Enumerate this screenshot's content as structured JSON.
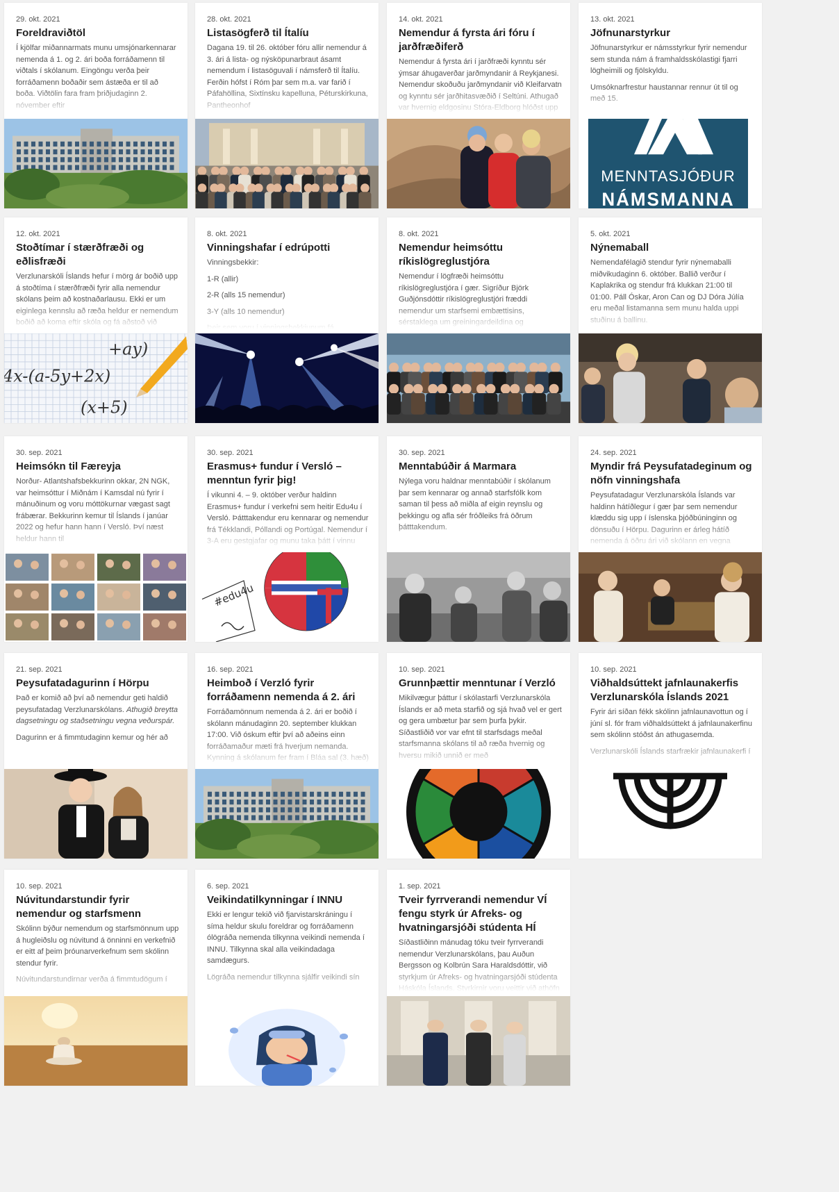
{
  "colors": {
    "background": "#f1f1f1",
    "card": "#ffffff",
    "title": "#222222",
    "body": "#555555"
  },
  "cards": [
    {
      "date": "29. okt. 2021",
      "title": "Foreldraviðtöl",
      "body": [
        "Í kjölfar miðannarmats munu umsjónarkennarar nemenda á 1. og 2. ári boða forráðamenn til viðtals í skólanum. Eingöngu verða þeir forráðamenn boðaðir sem ástæða er til að boða. Viðtölin fara fram þriðjudaginn 2. nóvember eftir"
      ],
      "image_icon": "school-building-image"
    },
    {
      "date": "28. okt. 2021",
      "title": "Listasögferð til Ítalíu",
      "body": [
        "Dagana 19. til 26. október fóru allir nemendur á 3. ári á lista- og nýsköpunarbraut ásamt nemendum í listasöguvali í námsferð til Ítalíu. Ferðin hófst í Róm þar sem m.a. var farið í Páfahöllina, Sixtínsku kapelluna, Péturskirkuna, Pantheonhof"
      ],
      "image_icon": "group-in-rome-image"
    },
    {
      "date": "14. okt. 2021",
      "title": "Nemendur á fyrsta ári fóru í jarðfræðiferð",
      "body": [
        "Nemendur á fyrsta ári í jarðfræði kynntu sér ýmsar áhugaverðar jarðmyndanir á Reykjanesi. Nemendur skoðuðu jarðmyndanir við Kleifarvatn og kynntu sér jarðhitasvæðið í Seltúni. Athugað var hvernig eldgosinu Stóra-Eldborg hlóðst upp og"
      ],
      "image_icon": "students-field-trip-image"
    },
    {
      "date": "13. okt. 2021",
      "title": "Jöfnunarstyrkur",
      "body": [
        "Jöfnunarstyrkur er námsstyrkur fyrir nemendur sem stunda nám á framhaldsskólastigi fjarri lögheimili og fjölskyldu.",
        "Umsóknarfrestur haustannar rennur út til og með 15."
      ],
      "image_icon": "menntasjodur-logo",
      "logo_line1": "MENNTASJÓÐUR",
      "logo_line2": "NÁMSMANNA"
    },
    {
      "date": "12. okt. 2021",
      "title": "Stoðtímar í stærðfræði og eðlisfræði",
      "body": [
        "Verzlunarskóli Íslands hefur í mörg ár boðið upp á stoðtíma í stærðfræði fyrir alla nemendur skólans þeim að kostnaðarlausu. Ekki er um eiginlega kennslu að ræða heldur er nemendum boðið að koma eftir skóla og fá aðstoð við heimanám og aðra"
      ],
      "image_icon": "math-pencil-image",
      "formula_top": "+ay)",
      "formula_mid": "4x-(a-5y+2x)",
      "formula_bot": "(x+5)"
    },
    {
      "date": "8. okt. 2021",
      "title": "Vinningshafar í edrúpotti",
      "body": [
        "Vinningsbekkir:",
        "1-R (allir)",
        "2-R (alls 15 nemendur)",
        "3-Y (alls 10 nemendur)",
        "Þeir sem voru í vinningsbekkjunum fá edrúpottinn"
      ],
      "image_icon": "concert-lights-image"
    },
    {
      "date": "8. okt. 2021",
      "title": "Nemendur heimsóttu ríkislögreglustjóra",
      "body": [
        "Nemendur í lögfræði heimsóttu ríkislögreglustjóra í gær. Sigríður Björk Guðjónsdóttir ríkislögreglustjóri fræddi nemendur um starfsemi embættisins, sérstaklega um greiningardeildina og almannavarnir. Að lokum kennarar eintdi neddi lög"
      ],
      "image_icon": "group-photo-image"
    },
    {
      "date": "5. okt. 2021",
      "title": "Nýnemaball",
      "body": [
        "Nemendafélagið stendur fyrir nýnemaballi miðvikudaginn 6. október. Ballið verður í Kaplakrika og stendur frá klukkan 21:00 til 01:00. Páll Óskar, Aron Can og DJ Dóra Júlía eru meðal listamanna sem munu halda uppi stuðinu á ballinu."
      ],
      "image_icon": "students-party-image"
    },
    {
      "date": "30. sep. 2021",
      "title": "Heimsókn til Færeyja",
      "body": [
        "Norður- Atlantshafsbekkurinn okkar, 2N NGK, var heimsóttur í Miðnám í Kamsdal nú fyrir í mánuðinum og voru móttökurnar vægast sagt frábærar. Bekkurinn kemur til Íslands í janúar 2022 og hefur hann hann í Versló. Því næst heldur hann til"
      ],
      "image_icon": "photo-collage-image"
    },
    {
      "date": "30. sep. 2021",
      "title": "Erasmus+ fundur í Versló – menntun fyrir þig!",
      "body": [
        "Í vikunni 4. – 9. október verður haldinn Erasmus+ fundur í verkefni sem heitir Edu4u í Versló. Þátttakendur eru kennarar og nemendur frá Tékklandi, Póllandi og Portúgal. Nemendur í 3-A eru gestgjafar og munu taka þátt í vinnu"
      ],
      "image_icon": "erasmus-drawing-image",
      "drawing_label": "#edu4u"
    },
    {
      "date": "30. sep. 2021",
      "title": "Menntabúðir á Marmara",
      "body": [
        "Nýlega voru haldnar menntabúðir í skólanum þar sem kennarar og annað starfsfólk kom saman til þess að miðla af eigin reynslu og þekkingu og afla sér fróðleiks frá öðrum þátttakendum."
      ],
      "image_icon": "workshop-photo-image"
    },
    {
      "date": "24. sep. 2021",
      "title": "Myndir frá Peysufatadeginum og nöfn vinningshafa",
      "body": [
        "Peysufatadagur Verzlunarskóla Íslands var haldinn hátíðlegur í gær þar sem nemendur klæddu sig upp í íslenska þjóðbúninginn og dönsuðu í Hörpu. Dagurinn er árleg hátíð nemenda á öðru ári við skólann en vegna kórónuveirufaraldursins nemendur"
      ],
      "image_icon": "dancing-students-image"
    },
    {
      "date": "21. sep. 2021",
      "title": "Peysufatadagurinn í Hörpu",
      "body": [
        "Það er komið að því að nemendur geti haldið peysufatadag Verzlunarskólans. [em]Athugið breytta dagsetningu og staðsetningu vegna veðurspár.",
        "Dagurinn er á fimmtudaginn kemur og hér að"
      ],
      "image_icon": "couple-costume-image"
    },
    {
      "date": "16. sep. 2021",
      "title": "Heimboð í Verzló fyrir forráðamenn nemenda á 2. ári",
      "body": [
        "Forráðamönnum nemenda á 2. ári er boðið í skólann mánudaginn 20. september klukkan 17:00. Við óskum eftir því að aðeins einn forráðamaður mæti frá hverjum nemanda. Kynning á skólanum fer fram í Bláa sal (3. hæð) þar sem farið verður yfir"
      ],
      "image_icon": "school-building-image"
    },
    {
      "date": "10. sep. 2021",
      "title": "Grunnþættir menntunar í Verzló",
      "body": [
        "Mikilvægur þáttur í skólastarfi Verzlunarskóla Íslands er að meta starfið og sjá hvað vel er gert og gera umbætur þar sem þurfa þykir. Síðastliðið vor var efnt til starfsdags meðal starfsmanna skólans til að ræða hvernig og hversu mikið unnið er með"
      ],
      "image_icon": "education-pillars-wheel"
    },
    {
      "date": "10. sep. 2021",
      "title": "Viðhaldsúttekt jafnlaunakerfis Verzlunarskóla Íslands 2021",
      "body": [
        "Fyrir ári síðan fékk skólinn jafnlaunavottun og í júní sl. fór fram viðhaldsúttekt á jafnlaunakerfinu sem skólinn stóðst án athugasemda.",
        "Verzlunarskóli Íslands starfrækir jafnlaunakerfi í"
      ],
      "image_icon": "equal-pay-logo"
    },
    {
      "date": "10. sep. 2021",
      "title": "Núvitundarstundir fyrir nemendur og starfsmenn",
      "body": [
        "Skólinn býður nemendum og starfsmönnum upp á hugleiðslu og núvitund á önninni en verkefnið er eitt af þeim þróunarverkefnum sem skólinn stendur fyrir.",
        "Núvitundarstundirnar verða á fimmtudögum í"
      ],
      "image_icon": "meditation-image"
    },
    {
      "date": "6. sep. 2021",
      "title": "Veikindatilkynningar í INNU",
      "body": [
        "Ekki er lengur tekið við fjarvistarskráningu í síma heldur skulu foreldrar og forráðamenn ólögráða nemenda tilkynna veikindi nemenda í INNU. Tilkynna skal alla veikindadaga samdægurs.",
        "Lögráða nemendur tilkynna sjálfir veikindi sín"
      ],
      "image_icon": "sick-girl-illustration"
    },
    {
      "date": "1. sep. 2021",
      "title": "Tveir fyrrverandi nemendur VÍ fengu styrk úr Afreks- og hvatningarsjóði stúdenta HÍ",
      "body": [
        "Síðastliðinn mánudag tóku tveir fyrrverandi nemendur Verzlunarskólans, þau Auðun Bergsson og Kolbrún Sara Haraldsdóttir, við styrkjum úr Afreks- og hvatningarsjóði stúdenta Háskóla Íslands. Styrkirnir voru veittir við athöfn í Hátíðasal"
      ],
      "image_icon": "award-ceremony-image"
    }
  ]
}
